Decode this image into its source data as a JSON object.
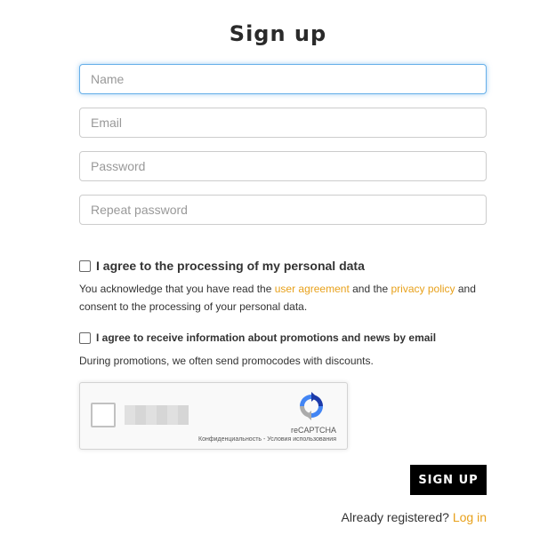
{
  "title": "Sign up",
  "fields": {
    "name_placeholder": "Name",
    "email_placeholder": "Email",
    "password_placeholder": "Password",
    "repeat_password_placeholder": "Repeat password"
  },
  "consent_personal_data": {
    "label": "I agree to the processing of my personal data",
    "text_1": "You acknowledge that you have read the ",
    "link_1": "user agreement",
    "text_2": " and the ",
    "link_2": "privacy policy",
    "text_3": " and consent to the processing of your personal data."
  },
  "consent_promotions": {
    "label": "I agree to receive information about promotions and news by email",
    "note": "During promotions, we often send promocodes with discounts."
  },
  "captcha": {
    "brand": "reCAPTCHA",
    "privacy_link": "Конфиденциальность",
    "separator": " - ",
    "terms_link": "Условия использования",
    "logo_icon": "recaptcha-logo-icon"
  },
  "submit_label": "SIGN UP",
  "footer": {
    "text": "Already registered? ",
    "login_link": "Log in"
  },
  "colors": {
    "accent_link": "#e8a11b",
    "button_bg": "#000000",
    "focus_border": "#66afe9"
  }
}
